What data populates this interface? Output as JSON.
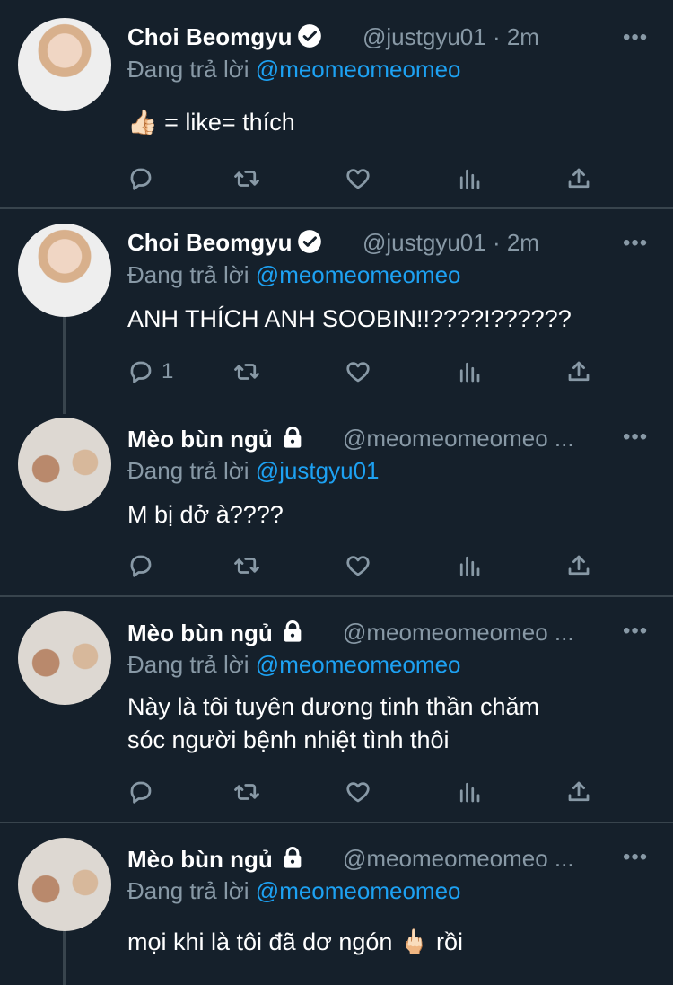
{
  "tweets": [
    {
      "name": "Choi Beomgyu",
      "handle": "@justgyu01",
      "time": "· 2m",
      "replying_prefix": "Đang trả lời",
      "replying_to": "@meomeomeomeo",
      "text": "👍🏻 = like= thích",
      "reply_count": ""
    },
    {
      "name": "Choi Beomgyu",
      "handle": "@justgyu01",
      "time": "· 2m",
      "replying_prefix": "Đang trả lời",
      "replying_to": "@meomeomeomeo",
      "text": "ANH THÍCH ANH SOOBIN!!????!??????",
      "reply_count": "1"
    },
    {
      "name": "Mèo bùn ngủ",
      "handle": "@meomeomeomeo ...",
      "time": "",
      "replying_prefix": "Đang trả lời",
      "replying_to": "@justgyu01",
      "text": "M bị dở à????",
      "reply_count": ""
    },
    {
      "name": "Mèo bùn ngủ",
      "handle": "@meomeomeomeo ...",
      "time": "",
      "replying_prefix": "Đang trả lời",
      "replying_to": "@meomeomeomeo",
      "text_lines": [
        "Này là tôi tuyên dương tinh thần chăm",
        "sóc người bệnh nhiệt tình thôi"
      ],
      "reply_count": ""
    },
    {
      "name": "Mèo bùn ngủ",
      "handle": "@meomeomeomeo ...",
      "time": "",
      "replying_prefix": "Đang trả lời",
      "replying_to": "@meomeomeomeo",
      "text": "mọi khi là tôi đã dơ ngón 🖕🏻 rồi",
      "reply_count": ""
    }
  ],
  "more_label": "•••",
  "colors": {
    "background": "#15202b",
    "secondary": "#8899a6",
    "link": "#1da1f2",
    "divider": "#38444d"
  },
  "icons": [
    "reply-icon",
    "retweet-icon",
    "like-icon",
    "analytics-icon",
    "share-icon",
    "verified-badge-icon",
    "lock-icon",
    "more-icon"
  ]
}
